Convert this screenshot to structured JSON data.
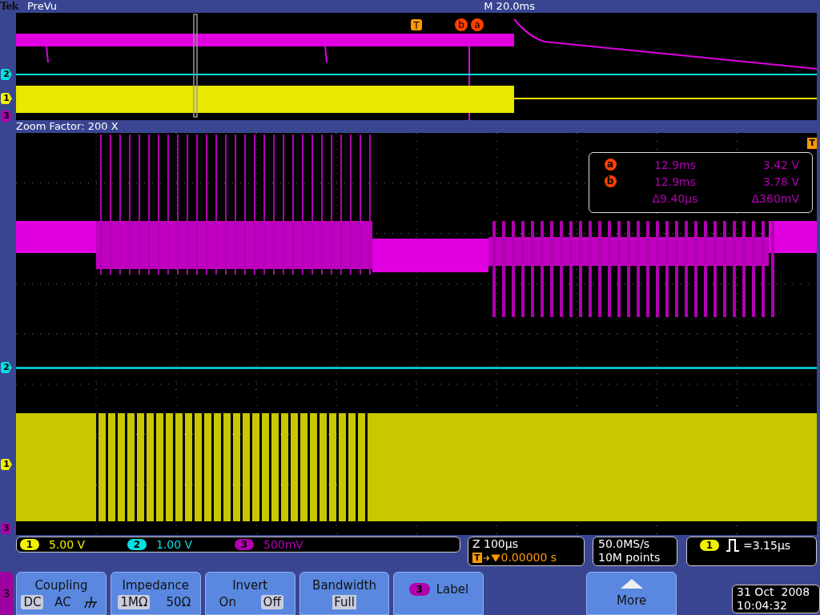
{
  "header": {
    "brand": "Tek",
    "mode": "PreVu",
    "timebase": "M 20.0ms"
  },
  "overview": {
    "trigger_marker": "T",
    "cursor_markers": [
      "b",
      "a"
    ],
    "channel_markers": [
      "2",
      "1",
      "3"
    ]
  },
  "zoom_label": "Zoom Factor: 200 X",
  "main": {
    "channel_markers": [
      "2",
      "1",
      "3"
    ],
    "trigger_corner": "T",
    "cursor_readout": [
      {
        "marker": "a",
        "time": "12.9ms",
        "value": "3.42 V"
      },
      {
        "marker": "b",
        "time": "12.9ms",
        "value": "3.78 V"
      },
      {
        "time": "Δ9.40µs",
        "value": "Δ360mV"
      }
    ]
  },
  "channels": [
    {
      "number": "1",
      "scale": "5.00 V",
      "color": "#f0f000"
    },
    {
      "number": "2",
      "scale": "1.00 V",
      "color": "#00e0e0"
    },
    {
      "number": "3",
      "scale": "500mV",
      "color": "#b000b0"
    }
  ],
  "horizontal": {
    "zoom": "Z 100µs",
    "trigger_icon": "T",
    "position": "0.00000 s"
  },
  "acquisition": {
    "sample_rate": "50.0MS/s",
    "record_length": "10M points"
  },
  "trigger": {
    "source": "1",
    "level": "=3.15µs"
  },
  "menu": {
    "channel": "3",
    "buttons": [
      {
        "kind": "options",
        "title": "Coupling",
        "options": [
          {
            "kind": "text",
            "label": "DC",
            "selected": true
          },
          {
            "kind": "text",
            "label": "AC",
            "selected": false
          },
          {
            "kind": "ground",
            "selected": false
          }
        ]
      },
      {
        "kind": "options",
        "title": "Impedance",
        "options": [
          {
            "kind": "text",
            "label": "1MΩ",
            "selected": true
          },
          {
            "kind": "text",
            "label": "50Ω",
            "selected": false
          }
        ]
      },
      {
        "kind": "options",
        "title": "Invert",
        "options": [
          {
            "kind": "text",
            "label": "On",
            "selected": false
          },
          {
            "kind": "text",
            "label": "Off",
            "selected": true
          }
        ]
      },
      {
        "kind": "value",
        "title": "Bandwidth",
        "value": "Full"
      },
      {
        "kind": "badge",
        "title": "Label",
        "badge": "3"
      },
      {
        "kind": "more",
        "title": "More"
      }
    ]
  },
  "datetime": {
    "date": "31 Oct  2008",
    "time": "10:04:32"
  }
}
